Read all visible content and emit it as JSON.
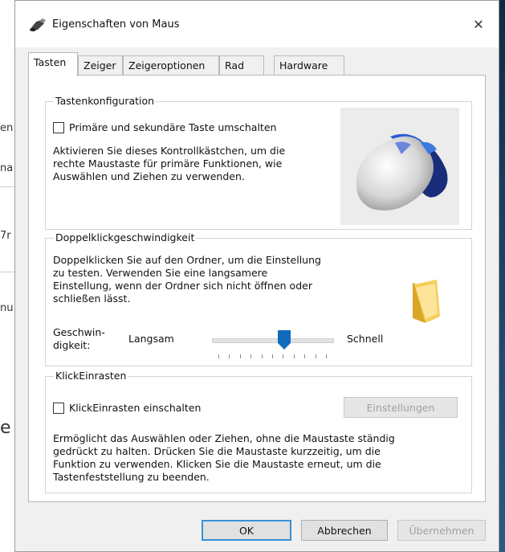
{
  "background": {
    "fragments": [
      "en",
      "na",
      "7r",
      "nu",
      "e"
    ]
  },
  "window": {
    "title": "Eigenschaften von Maus",
    "close_glyph": "✕"
  },
  "tabs": [
    "Tasten",
    "Zeiger",
    "Zeigeroptionen",
    "Rad",
    "Hardware"
  ],
  "active_tab": "Tasten",
  "button_config": {
    "title": "Tastenkonfiguration",
    "checkbox_label": "Primäre und sekundäre Taste umschalten",
    "checked": false,
    "description_lines": [
      "Aktivieren Sie dieses Kontrollkästchen, um die",
      "rechte Maustaste für primäre Funktionen, wie",
      "Auswählen und Ziehen zu verwenden."
    ]
  },
  "double_click": {
    "title": "Doppelklickgeschwindigkeit",
    "description_lines": [
      "Doppelklicken Sie auf den Ordner, um die Einstellung",
      "zu testen. Verwenden Sie eine langsamere",
      "Einstellung, wenn der Ordner sich nicht öffnen oder",
      "schließen lässt."
    ],
    "speed_label_lines": [
      "Geschwin-",
      "digkeit:"
    ],
    "slow_label": "Langsam",
    "fast_label": "Schnell",
    "slider_value": 0.6
  },
  "click_lock": {
    "title": "KlickEinrasten",
    "checkbox_label": "KlickEinrasten einschalten",
    "checked": false,
    "settings_button": "Einstellungen",
    "description_lines": [
      "Ermöglicht das Auswählen oder Ziehen, ohne die Maustaste ständig",
      "gedrückt zu halten. Drücken Sie die Maustaste kurzzeitig, um die",
      "Funktion zu verwenden. Klicken Sie die Maustaste erneut, um die",
      "Tastenfeststellung zu beenden."
    ]
  },
  "footer": {
    "ok": "OK",
    "cancel": "Abbrechen",
    "apply": "Übernehmen"
  },
  "icons": {
    "title": "mouse-properties-icon",
    "illustration": "mouse-icon",
    "folder": "folder-icon"
  },
  "colors": {
    "accent": "#3b8fd6",
    "slider_thumb": "#0f6cbd"
  }
}
